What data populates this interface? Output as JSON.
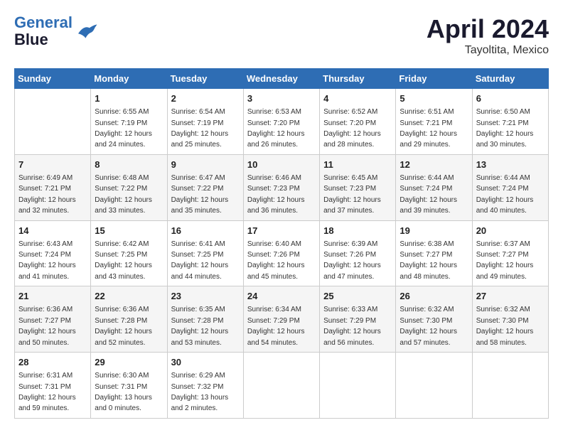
{
  "header": {
    "logo_line1": "General",
    "logo_line2": "Blue",
    "month": "April 2024",
    "location": "Tayoltita, Mexico"
  },
  "columns": [
    "Sunday",
    "Monday",
    "Tuesday",
    "Wednesday",
    "Thursday",
    "Friday",
    "Saturday"
  ],
  "weeks": [
    [
      {
        "day": "",
        "info": ""
      },
      {
        "day": "1",
        "info": "Sunrise: 6:55 AM\nSunset: 7:19 PM\nDaylight: 12 hours\nand 24 minutes."
      },
      {
        "day": "2",
        "info": "Sunrise: 6:54 AM\nSunset: 7:19 PM\nDaylight: 12 hours\nand 25 minutes."
      },
      {
        "day": "3",
        "info": "Sunrise: 6:53 AM\nSunset: 7:20 PM\nDaylight: 12 hours\nand 26 minutes."
      },
      {
        "day": "4",
        "info": "Sunrise: 6:52 AM\nSunset: 7:20 PM\nDaylight: 12 hours\nand 28 minutes."
      },
      {
        "day": "5",
        "info": "Sunrise: 6:51 AM\nSunset: 7:21 PM\nDaylight: 12 hours\nand 29 minutes."
      },
      {
        "day": "6",
        "info": "Sunrise: 6:50 AM\nSunset: 7:21 PM\nDaylight: 12 hours\nand 30 minutes."
      }
    ],
    [
      {
        "day": "7",
        "info": "Sunrise: 6:49 AM\nSunset: 7:21 PM\nDaylight: 12 hours\nand 32 minutes."
      },
      {
        "day": "8",
        "info": "Sunrise: 6:48 AM\nSunset: 7:22 PM\nDaylight: 12 hours\nand 33 minutes."
      },
      {
        "day": "9",
        "info": "Sunrise: 6:47 AM\nSunset: 7:22 PM\nDaylight: 12 hours\nand 35 minutes."
      },
      {
        "day": "10",
        "info": "Sunrise: 6:46 AM\nSunset: 7:23 PM\nDaylight: 12 hours\nand 36 minutes."
      },
      {
        "day": "11",
        "info": "Sunrise: 6:45 AM\nSunset: 7:23 PM\nDaylight: 12 hours\nand 37 minutes."
      },
      {
        "day": "12",
        "info": "Sunrise: 6:44 AM\nSunset: 7:24 PM\nDaylight: 12 hours\nand 39 minutes."
      },
      {
        "day": "13",
        "info": "Sunrise: 6:44 AM\nSunset: 7:24 PM\nDaylight: 12 hours\nand 40 minutes."
      }
    ],
    [
      {
        "day": "14",
        "info": "Sunrise: 6:43 AM\nSunset: 7:24 PM\nDaylight: 12 hours\nand 41 minutes."
      },
      {
        "day": "15",
        "info": "Sunrise: 6:42 AM\nSunset: 7:25 PM\nDaylight: 12 hours\nand 43 minutes."
      },
      {
        "day": "16",
        "info": "Sunrise: 6:41 AM\nSunset: 7:25 PM\nDaylight: 12 hours\nand 44 minutes."
      },
      {
        "day": "17",
        "info": "Sunrise: 6:40 AM\nSunset: 7:26 PM\nDaylight: 12 hours\nand 45 minutes."
      },
      {
        "day": "18",
        "info": "Sunrise: 6:39 AM\nSunset: 7:26 PM\nDaylight: 12 hours\nand 47 minutes."
      },
      {
        "day": "19",
        "info": "Sunrise: 6:38 AM\nSunset: 7:27 PM\nDaylight: 12 hours\nand 48 minutes."
      },
      {
        "day": "20",
        "info": "Sunrise: 6:37 AM\nSunset: 7:27 PM\nDaylight: 12 hours\nand 49 minutes."
      }
    ],
    [
      {
        "day": "21",
        "info": "Sunrise: 6:36 AM\nSunset: 7:27 PM\nDaylight: 12 hours\nand 50 minutes."
      },
      {
        "day": "22",
        "info": "Sunrise: 6:36 AM\nSunset: 7:28 PM\nDaylight: 12 hours\nand 52 minutes."
      },
      {
        "day": "23",
        "info": "Sunrise: 6:35 AM\nSunset: 7:28 PM\nDaylight: 12 hours\nand 53 minutes."
      },
      {
        "day": "24",
        "info": "Sunrise: 6:34 AM\nSunset: 7:29 PM\nDaylight: 12 hours\nand 54 minutes."
      },
      {
        "day": "25",
        "info": "Sunrise: 6:33 AM\nSunset: 7:29 PM\nDaylight: 12 hours\nand 56 minutes."
      },
      {
        "day": "26",
        "info": "Sunrise: 6:32 AM\nSunset: 7:30 PM\nDaylight: 12 hours\nand 57 minutes."
      },
      {
        "day": "27",
        "info": "Sunrise: 6:32 AM\nSunset: 7:30 PM\nDaylight: 12 hours\nand 58 minutes."
      }
    ],
    [
      {
        "day": "28",
        "info": "Sunrise: 6:31 AM\nSunset: 7:31 PM\nDaylight: 12 hours\nand 59 minutes."
      },
      {
        "day": "29",
        "info": "Sunrise: 6:30 AM\nSunset: 7:31 PM\nDaylight: 13 hours\nand 0 minutes."
      },
      {
        "day": "30",
        "info": "Sunrise: 6:29 AM\nSunset: 7:32 PM\nDaylight: 13 hours\nand 2 minutes."
      },
      {
        "day": "",
        "info": ""
      },
      {
        "day": "",
        "info": ""
      },
      {
        "day": "",
        "info": ""
      },
      {
        "day": "",
        "info": ""
      }
    ]
  ]
}
